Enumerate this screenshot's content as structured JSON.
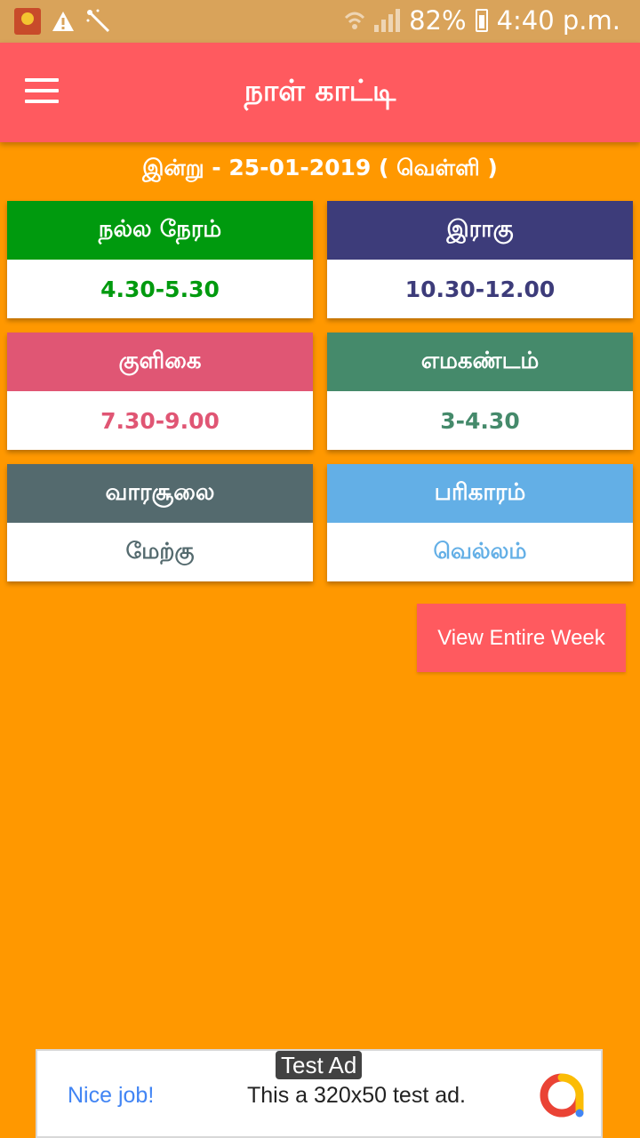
{
  "status_bar": {
    "battery": "82%",
    "time": "4:40 p.m.",
    "icons": [
      "app-logo-icon",
      "warning-icon",
      "magic-wand-icon",
      "wifi-icon",
      "signal-icon",
      "battery-charging-icon"
    ]
  },
  "app_bar": {
    "title": "நாள் காட்டி",
    "menu_icon": "menu-icon"
  },
  "today": "இன்று - 25-01-2019 ( வெள்ளி )",
  "cards": [
    {
      "label": "நல்ல நேரம்",
      "value": "4.30-5.30",
      "head_color": "#009A0E",
      "value_color": "#009A0E"
    },
    {
      "label": "இராகு",
      "value": "10.30-12.00",
      "head_color": "#3D3C7A",
      "value_color": "#3D3C7A"
    },
    {
      "label": "குளிகை",
      "value": "7.30-9.00",
      "head_color": "#E05674",
      "value_color": "#E05674"
    },
    {
      "label": "எமகண்டம்",
      "value": "3-4.30",
      "head_color": "#458A6B",
      "value_color": "#458A6B"
    },
    {
      "label": "வாரசூலை",
      "value": "மேற்கு",
      "head_color": "#546A6E",
      "value_color": "#546A6E"
    },
    {
      "label": "பரிகாரம்",
      "value": "வெல்லம்",
      "head_color": "#63AFE6",
      "value_color": "#63AFE6"
    }
  ],
  "week_button": "View Entire Week",
  "ad": {
    "tag": "Test Ad",
    "left_text": "Nice job!",
    "text": "This a 320x50 test ad."
  }
}
